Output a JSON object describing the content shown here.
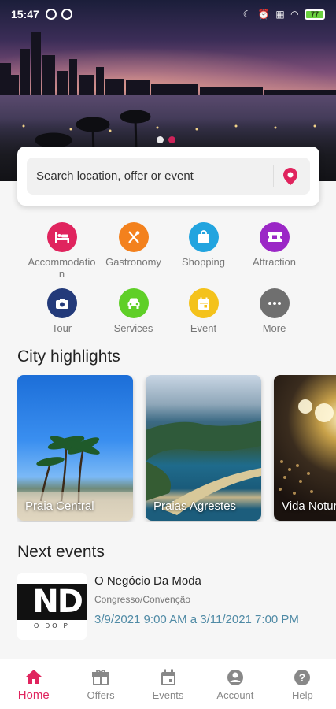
{
  "status_bar": {
    "time": "15:47",
    "battery": "77"
  },
  "search": {
    "placeholder": "Search location, offer or event"
  },
  "categories": [
    {
      "label": "Accommodation",
      "color": "#e0245e",
      "icon": "bed-icon"
    },
    {
      "label": "Gastronomy",
      "color": "#f3811d",
      "icon": "fork-knife-icon"
    },
    {
      "label": "Shopping",
      "color": "#22a4df",
      "icon": "shopping-bag-icon"
    },
    {
      "label": "Attraction",
      "color": "#9b27c6",
      "icon": "ticket-icon"
    },
    {
      "label": "Tour",
      "color": "#233a7a",
      "icon": "camera-icon"
    },
    {
      "label": "Services",
      "color": "#5fcf27",
      "icon": "car-icon"
    },
    {
      "label": "Event",
      "color": "#f4c21b",
      "icon": "calendar-icon"
    },
    {
      "label": "More",
      "color": "#6f6f6f",
      "icon": "more-icon"
    }
  ],
  "highlights": {
    "title": "City highlights",
    "items": [
      {
        "caption": "Praia Central"
      },
      {
        "caption": "Praias Agrestes"
      },
      {
        "caption": "Vida Noturna"
      }
    ]
  },
  "events": {
    "title": "Next events",
    "items": [
      {
        "title": "O Negócio Da Moda",
        "type": "Congresso/Convenção",
        "date": "3/9/2021 9:00 AM a 3/11/2021 7:00 PM",
        "thumb_text": "ND",
        "thumb_sub": "O DO P"
      }
    ]
  },
  "nav": [
    {
      "label": "Home",
      "icon": "home-icon",
      "active": true
    },
    {
      "label": "Offers",
      "icon": "gift-icon",
      "active": false
    },
    {
      "label": "Events",
      "icon": "calendar-icon",
      "active": false
    },
    {
      "label": "Account",
      "icon": "account-icon",
      "active": false
    },
    {
      "label": "Help",
      "icon": "help-icon",
      "active": false
    }
  ],
  "colors": {
    "accent": "#e0245e",
    "date_text": "#4f8aa5"
  }
}
